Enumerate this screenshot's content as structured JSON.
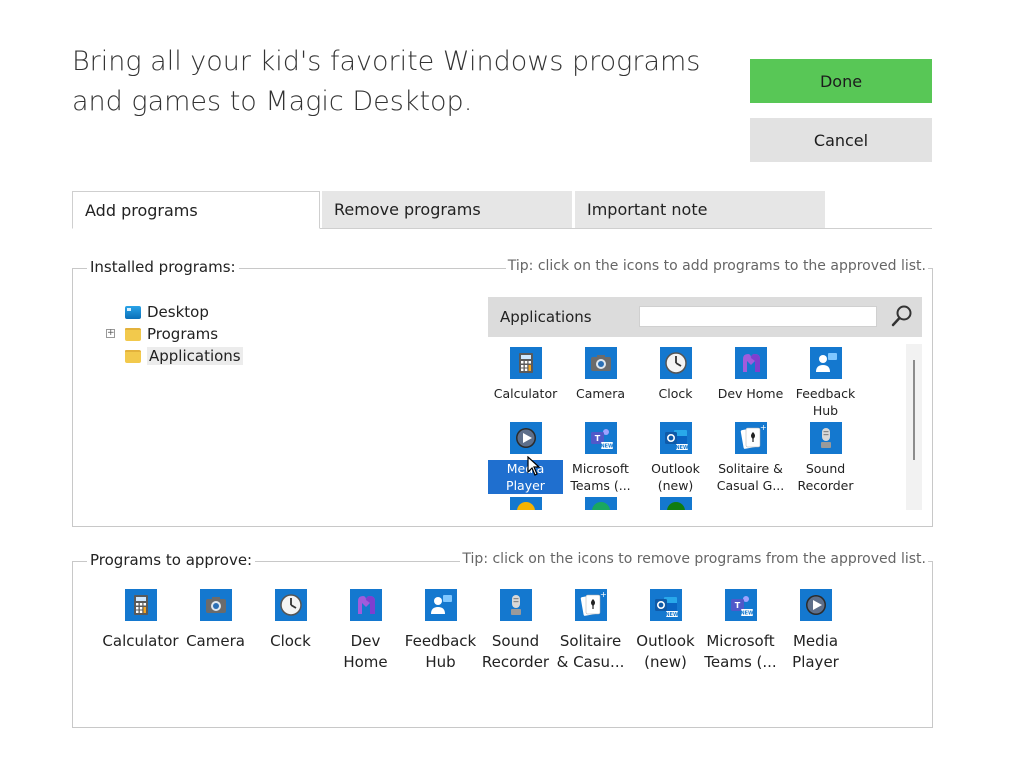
{
  "headline": "Bring all your kid's favorite Windows programs and games to Magic Desktop.",
  "buttons": {
    "done": "Done",
    "cancel": "Cancel"
  },
  "tabs": [
    {
      "label": "Add programs",
      "active": true
    },
    {
      "label": "Remove programs",
      "active": false
    },
    {
      "label": "Important note",
      "active": false
    }
  ],
  "installed": {
    "title": "Installed programs:",
    "tip": "Tip: click on the icons to add programs to the approved list.",
    "tree": [
      {
        "label": "Desktop",
        "icon": "desktop-icon"
      },
      {
        "label": "Programs",
        "icon": "folder-icon",
        "expander": "+"
      },
      {
        "label": "Applications",
        "icon": "folder-icon",
        "selected": true
      }
    ],
    "browser": {
      "title": "Applications",
      "search_value": "",
      "apps": [
        {
          "label": "Calculator",
          "icon": "calculator-icon"
        },
        {
          "label": "Camera",
          "icon": "camera-icon"
        },
        {
          "label": "Clock",
          "icon": "clock-icon"
        },
        {
          "label": "Dev Home",
          "icon": "dev-home-icon"
        },
        {
          "label": "Feedback Hub",
          "icon": "feedback-hub-icon"
        },
        {
          "label": "Media Player",
          "icon": "media-player-icon",
          "selected": true
        },
        {
          "label": "Microsoft Teams (...",
          "icon": "teams-icon"
        },
        {
          "label": "Outlook (new)",
          "icon": "outlook-icon"
        },
        {
          "label": "Solitaire & Casual G...",
          "icon": "solitaire-icon"
        },
        {
          "label": "Sound Recorder",
          "icon": "sound-recorder-icon"
        }
      ]
    }
  },
  "approve": {
    "title": "Programs to approve:",
    "tip": "Tip: click on the icons to remove programs from the approved list.",
    "apps": [
      {
        "label": "Calculator",
        "icon": "calculator-icon"
      },
      {
        "label": "Camera",
        "icon": "camera-icon"
      },
      {
        "label": "Clock",
        "icon": "clock-icon"
      },
      {
        "label": "Dev Home",
        "icon": "dev-home-icon"
      },
      {
        "label": "Feedback Hub",
        "icon": "feedback-hub-icon"
      },
      {
        "label": "Sound Recorder",
        "icon": "sound-recorder-icon"
      },
      {
        "label": "Solitaire & Casu...",
        "icon": "solitaire-icon"
      },
      {
        "label": "Outlook (new)",
        "icon": "outlook-icon"
      },
      {
        "label": "Microsoft Teams (...",
        "icon": "teams-icon"
      },
      {
        "label": "Media Player",
        "icon": "media-player-icon"
      }
    ]
  },
  "colors": {
    "done_green": "#58c756",
    "selection_blue": "#1f6fcf",
    "tile_blue": "#1b86d8"
  }
}
